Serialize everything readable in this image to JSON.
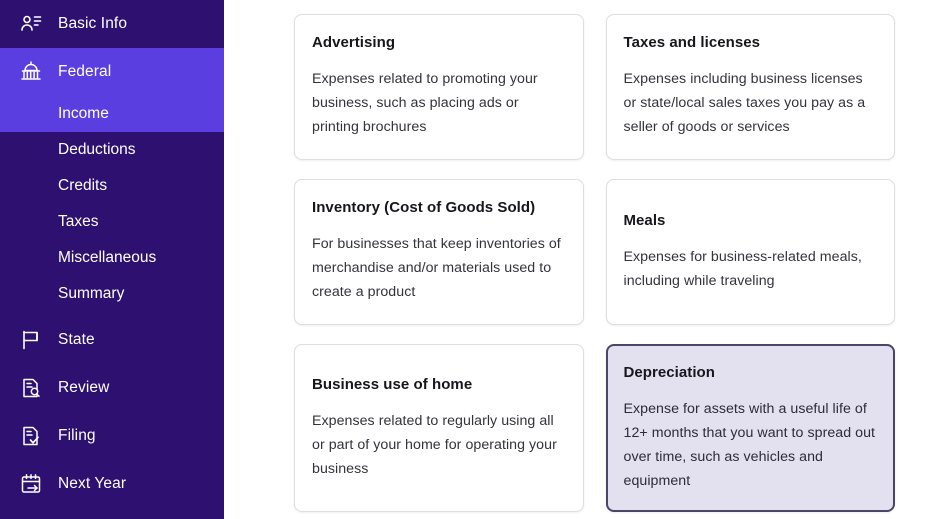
{
  "sidebar": {
    "background_color": "#2d1070",
    "active_color": "#5b3ee0",
    "items": [
      {
        "label": "Basic Info",
        "icon": "contact-person-icon",
        "active": false
      },
      {
        "label": "Federal",
        "icon": "capitol-building-icon",
        "active": true
      },
      {
        "label": "State",
        "icon": "flag-icon",
        "active": false
      },
      {
        "label": "Review",
        "icon": "document-search-icon",
        "active": false
      },
      {
        "label": "Filing",
        "icon": "document-check-icon",
        "active": false
      },
      {
        "label": "Next Year",
        "icon": "calendar-arrow-icon",
        "active": false
      }
    ],
    "federal_subitems": [
      {
        "label": "Income",
        "active": true
      },
      {
        "label": "Deductions",
        "active": false
      },
      {
        "label": "Credits",
        "active": false
      },
      {
        "label": "Taxes",
        "active": false
      },
      {
        "label": "Miscellaneous",
        "active": false
      },
      {
        "label": "Summary",
        "active": false
      }
    ]
  },
  "main": {
    "selected_card_fill": "#e3e1ef",
    "selected_card_border": "#4b4668",
    "cards": [
      {
        "title": "Advertising",
        "description": "Expenses related to promoting your business, such as placing ads or printing brochures",
        "selected": false
      },
      {
        "title": "Taxes and licenses",
        "description": "Expenses including business licenses or state/local sales taxes you pay as a seller of goods or services",
        "selected": false
      },
      {
        "title": "Inventory (Cost of Goods Sold)",
        "description": "For businesses that keep inventories of merchandise and/or materials used to create a product",
        "selected": false
      },
      {
        "title": "Meals",
        "description": "Expenses for business-related meals, including while traveling",
        "selected": false
      },
      {
        "title": "Business use of home",
        "description": "Expenses related to regularly using all or part of your home for operating your business",
        "selected": false
      },
      {
        "title": "Depreciation",
        "description": "Expense for assets with a useful life of 12+ months that you want to spread out over time, such as vehicles and equipment",
        "selected": true
      }
    ]
  }
}
